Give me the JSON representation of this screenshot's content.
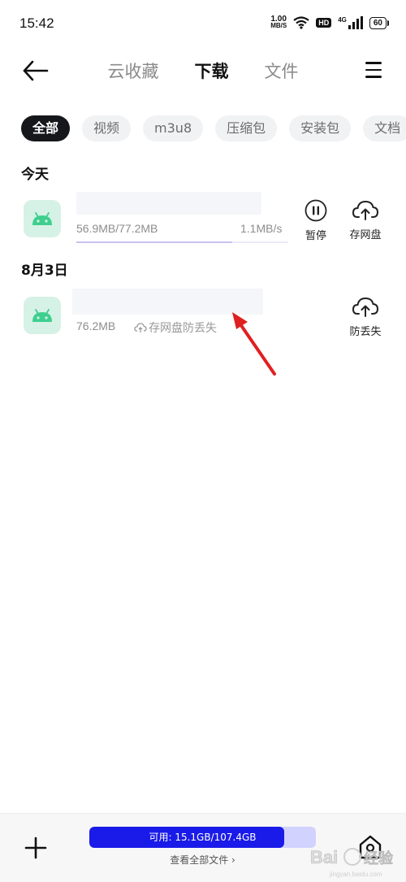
{
  "status_bar": {
    "time": "15:42",
    "net_speed_value": "1.00",
    "net_speed_unit": "MB/S",
    "hd_badge": "HD",
    "signal_label": "4G",
    "battery": "60"
  },
  "header": {
    "tabs": [
      {
        "label": "云收藏",
        "active": false
      },
      {
        "label": "下载",
        "active": true
      },
      {
        "label": "文件",
        "active": false
      }
    ]
  },
  "filters": {
    "chips": [
      {
        "label": "全部",
        "active": true
      },
      {
        "label": "视频",
        "active": false
      },
      {
        "label": "m3u8",
        "active": false
      },
      {
        "label": "压缩包",
        "active": false
      },
      {
        "label": "安装包",
        "active": false
      },
      {
        "label": "文档",
        "active": false
      }
    ]
  },
  "sections": [
    {
      "title": "今天",
      "item": {
        "size": "56.9MB/77.2MB",
        "speed": "1.1MB/s",
        "progress": 0.737,
        "pause_label": "暂停",
        "save_label": "存网盘"
      }
    },
    {
      "title": "8月3日",
      "item": {
        "size": "76.2MB",
        "save_hint": "存网盘防丢失",
        "save_label": "防丢失"
      }
    }
  ],
  "bottom": {
    "storage_text": "可用: 15.1GB/107.4GB",
    "storage_used_fraction": 0.86,
    "view_all": "查看全部文件 ›",
    "watermark": "Baidu 经验",
    "watermark_sub": "jingyan.baidu.com"
  },
  "colors": {
    "accent": "#1a1be8",
    "android_green": "#3ecf8e",
    "arrow_red": "#e02020"
  }
}
